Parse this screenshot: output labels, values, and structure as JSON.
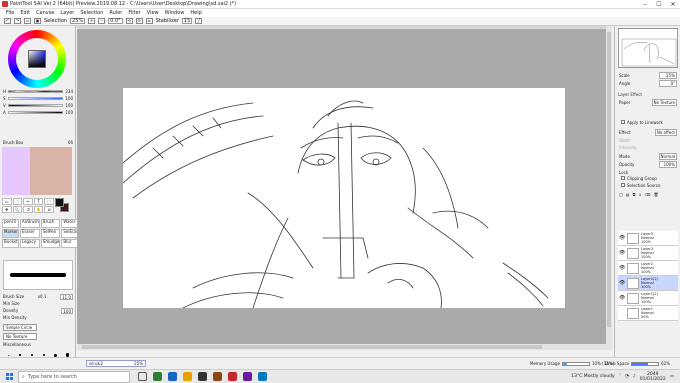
{
  "window": {
    "title": "PaintTool SAI Ver.2 (64bit) Preview.2019.08.12 - C:\\Users\\User\\Desktop\\Drawing\\sd.sai2 (*)",
    "minimize": "–",
    "maximize": "☐",
    "close": "✕"
  },
  "menu": [
    "File",
    "Edit",
    "Canvas",
    "Layer",
    "Selection",
    "Ruler",
    "Filter",
    "View",
    "Window",
    "Help"
  ],
  "toolbar": {
    "selection_label": "Selection",
    "zoom": "25%",
    "rotation": "0.0°",
    "stabilizer_label": "Stabilizer",
    "stabilizer_value": "15"
  },
  "color_sliders": [
    {
      "label": "H",
      "value": "234",
      "color": "#3a5bff"
    },
    {
      "label": "S",
      "value": "100",
      "color": "#2d59ff"
    },
    {
      "label": "V",
      "value": "100",
      "color": "#ffffff"
    },
    {
      "label": "A",
      "value": "100",
      "color": "#000000"
    }
  ],
  "brush_box": {
    "label": "Brush Box",
    "value": "66"
  },
  "swatches": {
    "left": "#e6c7ff",
    "right": "#d9b3a7"
  },
  "tools_row": [
    "▭",
    "◌",
    "✂",
    "T",
    "⬚",
    "✥",
    "🔍",
    "↺",
    "✋",
    "⊘"
  ],
  "brushes": [
    {
      "name": "pencil",
      "active": false
    },
    {
      "name": "AirBrush",
      "active": false
    },
    {
      "name": "Brush",
      "active": false
    },
    {
      "name": "Water",
      "active": false
    },
    {
      "name": "Marker",
      "active": true
    },
    {
      "name": "Eraser",
      "active": false
    },
    {
      "name": "SelPen",
      "active": false
    },
    {
      "name": "SelEras",
      "active": false
    },
    {
      "name": "Bucket",
      "active": false
    },
    {
      "name": "Legacy",
      "active": false
    },
    {
      "name": "Smudge",
      "active": false
    },
    {
      "name": "Blur",
      "active": false
    }
  ],
  "brush_params": {
    "brush_size_label": "Brush Size",
    "brush_size_mult": "x0.1",
    "brush_size_value": "11.0",
    "min_size_label": "Min Size",
    "density_label": "Density",
    "density_value": "100",
    "min_density_label": "Min Density",
    "simple_circle": "Simple Circle",
    "no_texture": "No Texture",
    "misc_label": "Miscellaneous"
  },
  "navigator": {
    "scale_label": "Scale",
    "scale_value": "25%",
    "angle_label": "Angle",
    "angle_value": "0°"
  },
  "layer_effect": {
    "title": "Layer Effect",
    "paper_label": "Paper",
    "paper_value": "No Texture",
    "apply_label": "Apply to Linework",
    "effect_label": "Effect",
    "effect_value": "No effect",
    "width_label": "Width",
    "strength_label": "Intensity"
  },
  "layer_props": {
    "mode_label": "Mode",
    "mode_value": "Normal",
    "opacity_label": "Opacity",
    "opacity_value": "100%",
    "lock_label": "Lock",
    "clipping_label": "Clipping Group",
    "source_label": "Selection Source"
  },
  "layers": [
    {
      "name": "Layer5",
      "mode": "Normal",
      "opacity": "100%",
      "selected": false
    },
    {
      "name": "Layer3",
      "mode": "Normal",
      "opacity": "100%",
      "selected": false
    },
    {
      "name": "Layer2",
      "mode": "Normal",
      "opacity": "100%",
      "selected": false
    },
    {
      "name": "Layer2(2)",
      "mode": "Normal",
      "opacity": "100%",
      "selected": true
    },
    {
      "name": "Layer1(2)",
      "mode": "Normal",
      "opacity": "100%",
      "selected": false
    },
    {
      "name": "Layer1",
      "mode": "Normal",
      "opacity": "50%",
      "selected": false
    }
  ],
  "status": {
    "doc_name": "sd.sai2",
    "doc_zoom": "25%",
    "memory_label": "Memory Usage",
    "memory_value": "10% (14%)",
    "memory_percent": 14,
    "drive_label": "Drive Space",
    "drive_value": "62%",
    "drive_percent": 62
  },
  "taskbar": {
    "search_placeholder": "Type here to search",
    "weather": "13°C  Mostly cloudy",
    "time": "2049",
    "date": "01/01/2022"
  }
}
